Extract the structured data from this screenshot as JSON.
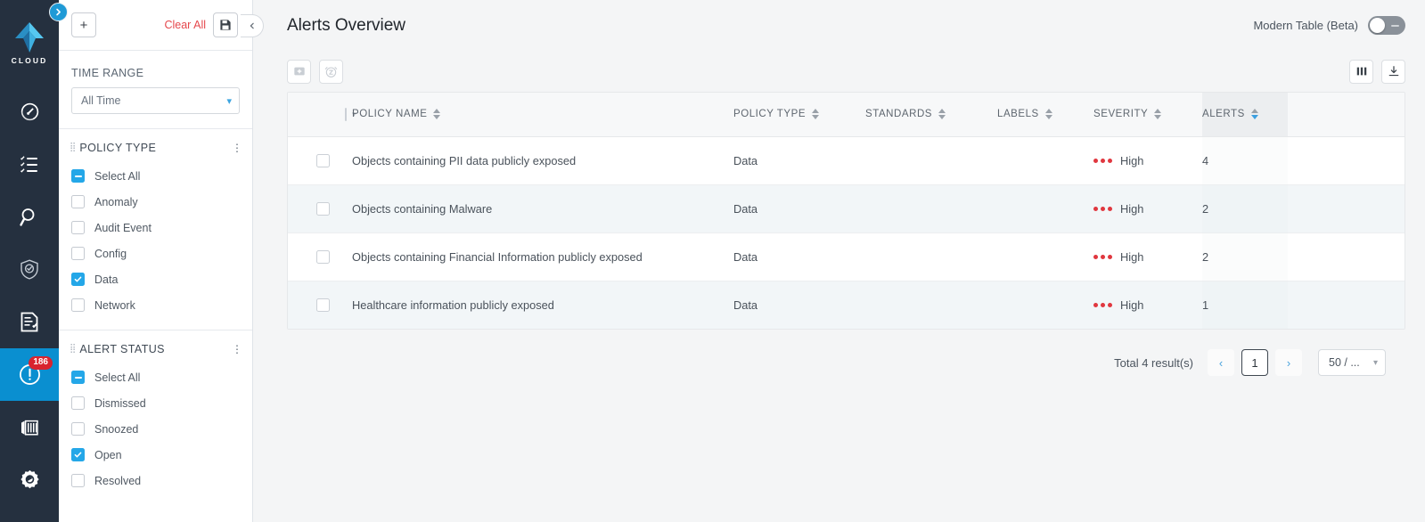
{
  "rail": {
    "logo_word": "CLOUD",
    "expander_icon": "chevron-right-icon",
    "items": [
      {
        "name": "dashboard",
        "icon": "speedometer-icon"
      },
      {
        "name": "investigate-list",
        "icon": "checklist-icon"
      },
      {
        "name": "search",
        "icon": "magnifier-icon"
      },
      {
        "name": "compliance",
        "icon": "shield-check-icon"
      },
      {
        "name": "reports",
        "icon": "document-check-icon"
      },
      {
        "name": "alerts",
        "icon": "alert-circle-icon",
        "badge": "186",
        "active": true
      },
      {
        "name": "containers",
        "icon": "container-icon"
      },
      {
        "name": "settings",
        "icon": "gear-icon"
      }
    ]
  },
  "filters": {
    "add_label": "+",
    "clear_all_label": "Clear All",
    "save_icon": "floppy-disk-icon",
    "collapse_icon": "chevron-left-icon",
    "time_range": {
      "title": "TIME RANGE",
      "value": "All Time"
    },
    "groups": [
      {
        "title": "POLICY TYPE",
        "options": [
          {
            "label": "Select All",
            "state": "indeterminate"
          },
          {
            "label": "Anomaly",
            "state": "unchecked"
          },
          {
            "label": "Audit Event",
            "state": "unchecked"
          },
          {
            "label": "Config",
            "state": "unchecked"
          },
          {
            "label": "Data",
            "state": "checked"
          },
          {
            "label": "Network",
            "state": "unchecked"
          }
        ]
      },
      {
        "title": "ALERT STATUS",
        "options": [
          {
            "label": "Select All",
            "state": "indeterminate"
          },
          {
            "label": "Dismissed",
            "state": "unchecked"
          },
          {
            "label": "Snoozed",
            "state": "unchecked"
          },
          {
            "label": "Open",
            "state": "checked"
          },
          {
            "label": "Resolved",
            "state": "unchecked"
          }
        ]
      }
    ]
  },
  "header": {
    "title": "Alerts Overview",
    "modern_table_label": "Modern Table (Beta)",
    "modern_table_on": false
  },
  "toolbar": {
    "dismiss_icon": "dismiss-box-icon",
    "snooze_icon": "alarm-clock-icon",
    "columns_icon": "columns-icon",
    "download_icon": "download-icon"
  },
  "table": {
    "columns": [
      {
        "key": "checkbox",
        "label": "",
        "sortable": false
      },
      {
        "key": "policy_name",
        "label": "POLICY NAME",
        "sortable": true,
        "sorted": false
      },
      {
        "key": "policy_type",
        "label": "POLICY TYPE",
        "sortable": true,
        "sorted": false
      },
      {
        "key": "standards",
        "label": "STANDARDS",
        "sortable": true,
        "sorted": false
      },
      {
        "key": "labels",
        "label": "LABELS",
        "sortable": true,
        "sorted": false
      },
      {
        "key": "severity",
        "label": "SEVERITY",
        "sortable": true,
        "sorted": false
      },
      {
        "key": "alerts",
        "label": "ALERTS",
        "sortable": true,
        "sorted": true,
        "sort_dir": "desc"
      }
    ],
    "rows": [
      {
        "policy_name": "Objects containing PII data publicly exposed",
        "policy_type": "Data",
        "standards": "",
        "labels": "",
        "severity": "High",
        "severity_level": 3,
        "alerts": "4",
        "selected": false
      },
      {
        "policy_name": "Objects containing Malware",
        "policy_type": "Data",
        "standards": "",
        "labels": "",
        "severity": "High",
        "severity_level": 3,
        "alerts": "2",
        "selected": false
      },
      {
        "policy_name": "Objects containing Financial Information publicly exposed",
        "policy_type": "Data",
        "standards": "",
        "labels": "",
        "severity": "High",
        "severity_level": 3,
        "alerts": "2",
        "selected": false
      },
      {
        "policy_name": "Healthcare information publicly exposed",
        "policy_type": "Data",
        "standards": "",
        "labels": "",
        "severity": "High",
        "severity_level": 3,
        "alerts": "1",
        "selected": false
      }
    ]
  },
  "pagination": {
    "total_label": "Total 4 result(s)",
    "prev_label": "‹",
    "next_label": "›",
    "current_page": "1",
    "page_size_label": "50 / ..."
  },
  "colors": {
    "accent_blue": "#24a7e8",
    "rail_bg": "#25303f",
    "danger_red": "#e0373f",
    "clear_red": "#e5484d",
    "active_nav": "#0a8fd0"
  }
}
